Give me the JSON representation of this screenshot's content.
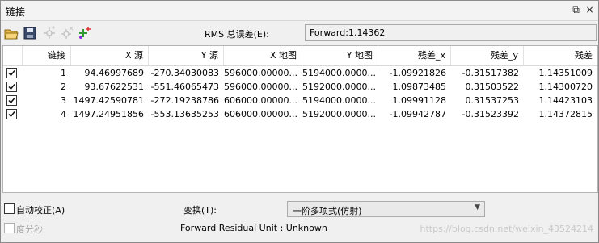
{
  "window": {
    "title": "链接",
    "restore_glyph": "⧉",
    "close_glyph": "×"
  },
  "toolbar": {
    "icons": [
      "open-folder-icon",
      "save-icon",
      "add-link-icon",
      "delete-link-icon",
      "add-point-icon"
    ],
    "rms_label": "RMS 总误差(E):",
    "rms_value": "Forward:1.14362"
  },
  "table": {
    "headers": [
      "链接",
      "X 源",
      "Y 源",
      "X 地图",
      "Y 地图",
      "残差_x",
      "残差_y",
      "残差"
    ],
    "rows": [
      {
        "checked": true,
        "id": "1",
        "x_src": "94.46997689",
        "y_src": "-270.34030083",
        "x_map": "596000.00000...",
        "y_map": "5194000.0000...",
        "res_x": "-1.09921826",
        "res_y": "-0.31517382",
        "res": "1.14351009"
      },
      {
        "checked": true,
        "id": "2",
        "x_src": "93.67622531",
        "y_src": "-551.46065473",
        "x_map": "596000.00000...",
        "y_map": "5192000.0000...",
        "res_x": "1.09873485",
        "res_y": "0.31503522",
        "res": "1.14300720"
      },
      {
        "checked": true,
        "id": "3",
        "x_src": "1497.42590781",
        "y_src": "-272.19238786",
        "x_map": "606000.00000...",
        "y_map": "5194000.0000...",
        "res_x": "1.09991128",
        "res_y": "0.31537253",
        "res": "1.14423103"
      },
      {
        "checked": true,
        "id": "4",
        "x_src": "1497.24951856",
        "y_src": "-553.13635253",
        "x_map": "606000.00000...",
        "y_map": "5192000.0000...",
        "res_x": "-1.09942787",
        "res_y": "-0.31523392",
        "res": "1.14372815"
      }
    ]
  },
  "bottom": {
    "auto_adjust_label": "自动校正(A)",
    "dms_label": "度分秒",
    "transform_label": "变换(T):",
    "transform_value": "一阶多项式(仿射)",
    "residual_unit": "Forward Residual Unit : Unknown",
    "watermark": "https://blog.csdn.net/weixin_43524214"
  },
  "colors": {
    "icon_green": "#2e9a2e",
    "icon_purple": "#8a2be2",
    "icon_red": "#d33",
    "folder": "#e0a020"
  }
}
